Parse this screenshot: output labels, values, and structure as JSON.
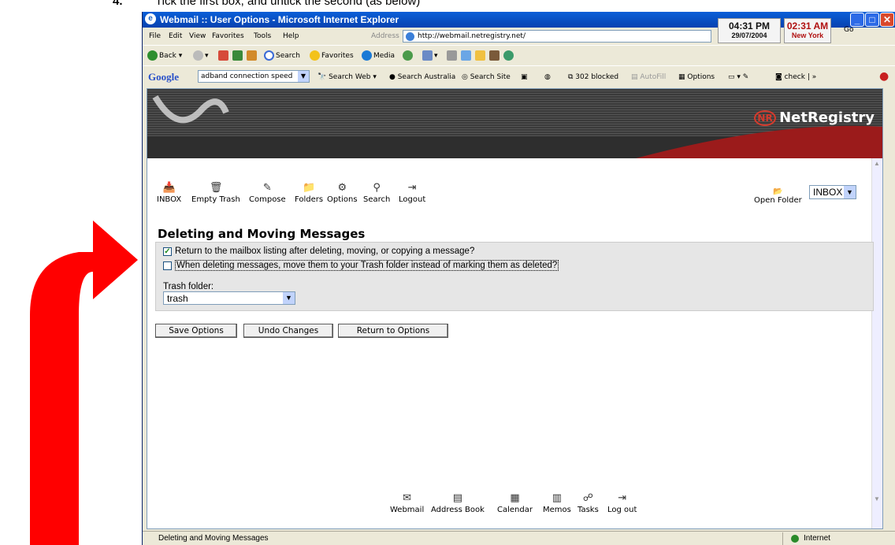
{
  "instruction": {
    "number": "4.",
    "text": "Tick the first box, and untick the second (as below)"
  },
  "window": {
    "title": "Webmail :: User Options - Microsoft Internet Explorer",
    "menu": [
      "File",
      "Edit",
      "View",
      "Favorites",
      "Tools",
      "Help"
    ],
    "address_label": "Address",
    "address_value": "http://webmail.netregistry.net/",
    "go_label": "Go",
    "clock_local_time": "04:31 PM",
    "clock_local_date": "29/07/2004",
    "clock_ny_time": "02:31 AM",
    "clock_ny_city": "New York"
  },
  "toolbar": {
    "back": "Back",
    "search": "Search",
    "favorites": "Favorites",
    "media": "Media"
  },
  "google_bar": {
    "logo": "Google",
    "query": "adband connection speed",
    "search_web": "Search Web",
    "search_australia": "Search Australia",
    "search_site": "Search Site",
    "blocked": "302 blocked",
    "autofill": "AutoFill",
    "options": "Options",
    "check": "check"
  },
  "banner": {
    "brand": "NetRegistry",
    "brand_mark": "NR"
  },
  "nav": [
    "INBOX",
    "Empty Trash",
    "Compose",
    "Folders",
    "Options",
    "Search",
    "Logout"
  ],
  "folder": {
    "open_label": "Open Folder",
    "selected": "INBOX"
  },
  "section": {
    "title": "Deleting and Moving Messages",
    "option1": "Return to the mailbox listing after deleting, moving, or copying a message?",
    "option1_checked": true,
    "option2": "When deleting messages, move them to your Trash folder instead of marking them as deleted?",
    "option2_checked": false,
    "trash_label": "Trash folder:",
    "trash_value": "trash"
  },
  "buttons": {
    "save": "Save Options",
    "undo": "Undo Changes",
    "return": "Return to Options"
  },
  "bottom_nav": [
    "Webmail",
    "Address Book",
    "Calendar",
    "Memos",
    "Tasks",
    "Log out"
  ],
  "status": {
    "text": "Deleting and Moving Messages",
    "zone": "Internet"
  },
  "colors": {
    "arrow": "#ff0000",
    "title_bar": "#0a5fd8",
    "banner": "#3a3a3a",
    "accent_red": "#d43a2c"
  }
}
